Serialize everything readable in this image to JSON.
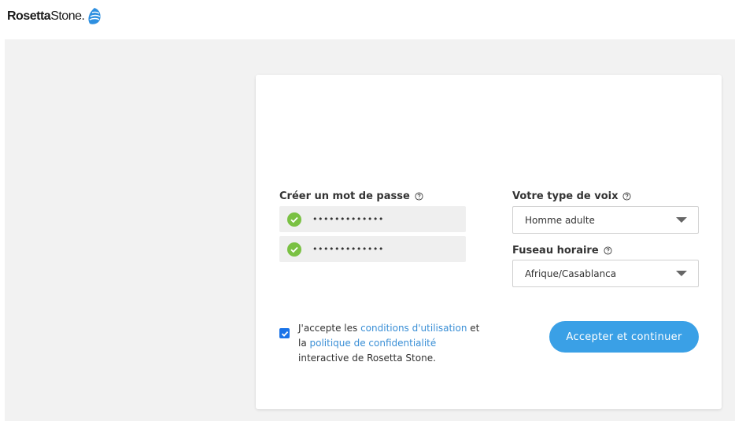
{
  "header": {
    "logo_bold": "Rosetta",
    "logo_light": "Stone",
    "logo_dot": "."
  },
  "password_section": {
    "label": "Créer un mot de passe",
    "fields": [
      {
        "value": "•••••••••••••",
        "status": "valid"
      },
      {
        "value": "•••••••••••••",
        "status": "valid"
      }
    ]
  },
  "voice_section": {
    "label": "Votre type de voix",
    "selected": "Homme adulte"
  },
  "timezone_section": {
    "label": "Fuseau horaire",
    "selected": "Afrique/Casablanca"
  },
  "terms": {
    "checked": true,
    "text_1": "J'accepte les ",
    "link_1": "conditions d'utilisation",
    "text_2": " et la ",
    "link_2": "politique de confidentialité",
    "text_3": " interactive de Rosetta Stone."
  },
  "submit": {
    "label": "Accepter et continuer"
  },
  "colors": {
    "accent": "#3aa0e6",
    "link": "#3a8fd6",
    "valid": "#7ac143",
    "checkbox": "#1a73e8"
  }
}
